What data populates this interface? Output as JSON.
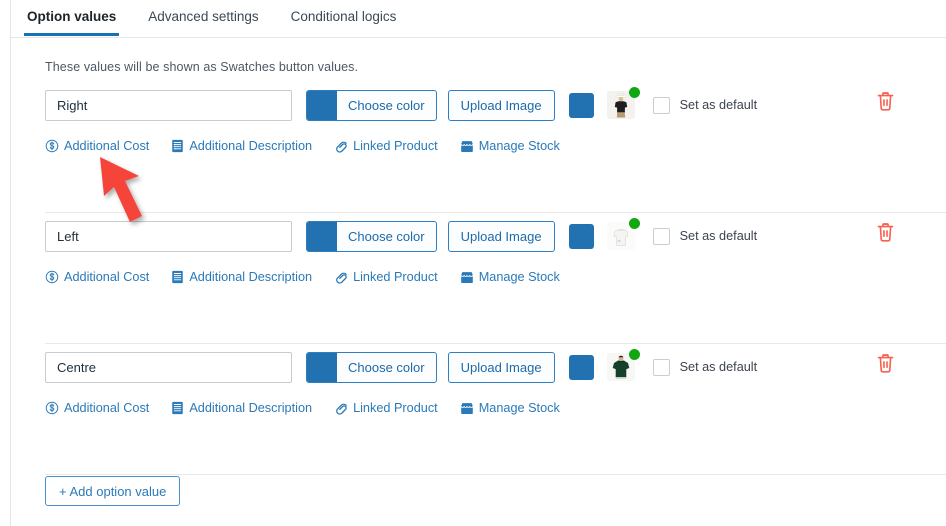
{
  "tabs": [
    {
      "label": "Option values",
      "active": true
    },
    {
      "label": "Advanced settings",
      "active": false
    },
    {
      "label": "Conditional logics",
      "active": false
    }
  ],
  "hint": "These values will be shown as Swatches button values.",
  "buttons": {
    "choose_color": "Choose color",
    "upload_image": "Upload Image",
    "set_as_default": "Set as default",
    "add_option_value": "+ Add option value"
  },
  "action_links": [
    {
      "label": "Additional Cost",
      "icon": "dollar-circle-icon"
    },
    {
      "label": "Additional Description",
      "icon": "document-lines-icon"
    },
    {
      "label": "Linked Product",
      "icon": "paperclip-link-icon"
    },
    {
      "label": "Manage Stock",
      "icon": "shop-awning-icon"
    }
  ],
  "colors": {
    "accent_blue": "#2271b1",
    "link_blue": "#2a7ab9",
    "tab_underline": "#1572b6",
    "trash_red": "#f9604f",
    "status_dot_green": "#11a711"
  },
  "rows": [
    {
      "value": "Right",
      "placeholder": "",
      "swatch_color": "#2271b1",
      "chip_color": "#2271b1",
      "thumbnail": "black-tshirt-white-hat-thumb",
      "set_as_default_checked": false,
      "delete_icon": "trash-icon"
    },
    {
      "value": "Left",
      "placeholder": "",
      "swatch_color": "#2271b1",
      "chip_color": "#2271b1",
      "thumbnail": "white-tshirt-thumb",
      "set_as_default_checked": false,
      "delete_icon": "trash-icon"
    },
    {
      "value": "Centre",
      "placeholder": "",
      "swatch_color": "#2271b1",
      "chip_color": "#2271b1",
      "thumbnail": "green-sweatshirt-thumb",
      "set_as_default_checked": false,
      "delete_icon": "trash-icon"
    }
  ],
  "annotation": {
    "type": "arrow",
    "color": "#f5453a",
    "points_to": "Additional Cost"
  }
}
